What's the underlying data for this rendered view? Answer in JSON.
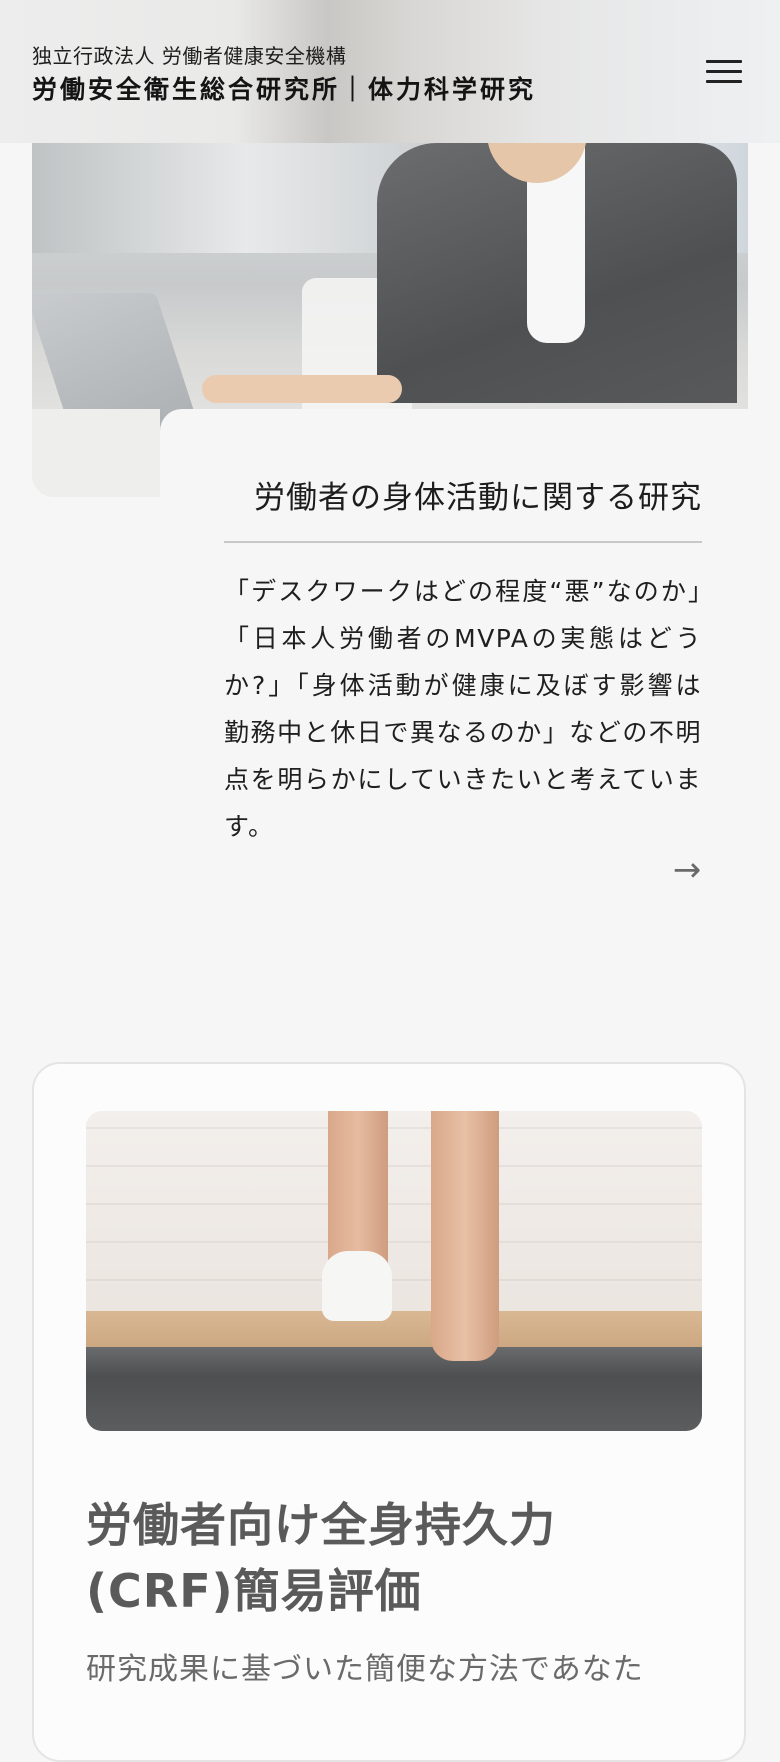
{
  "header": {
    "org_sub": "独立行政法人 労働者健康安全機構",
    "org_main": "労働安全衛生総合研究所｜体力科学研究"
  },
  "research": {
    "title": "労働者の身体活動に関する研究",
    "body": "「デスクワークはどの程度“悪”なのか」「日本人労働者のMVPAの実態はどうか?」「身体活動が健康に及ぼす影響は勤務中と休日で異なるのか」などの不明点を明らかにしていきたいと考えています。",
    "arrow": "→"
  },
  "crf": {
    "title": "労働者向け全身持久力(CRF)簡易評価",
    "description": "研究成果に基づいた簡便な方法であなた"
  }
}
